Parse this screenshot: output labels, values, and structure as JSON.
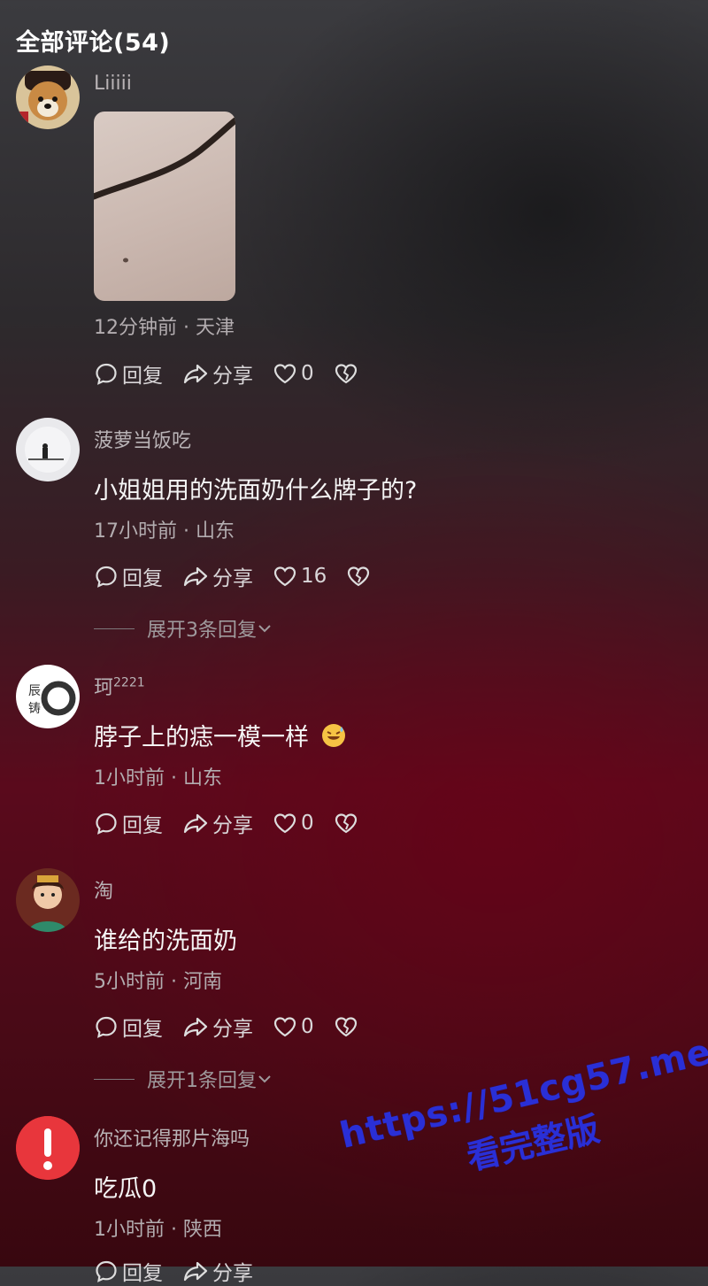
{
  "header": {
    "title": "全部评论(54)"
  },
  "comments": [
    {
      "name": "Liiiii",
      "text": "",
      "meta": "12分钟前 · 天津",
      "reply": "回复",
      "share": "分享",
      "likes": "0"
    },
    {
      "name": "菠萝当饭吃",
      "text": "小姐姐用的洗面奶什么牌子的?",
      "meta": "17小时前 · 山东",
      "reply": "回复",
      "share": "分享",
      "likes": "16",
      "expand": "展开3条回复"
    },
    {
      "name": "珂",
      "name_sup": "2221",
      "text": "脖子上的痣一模一样",
      "meta": "1小时前 · 山东",
      "reply": "回复",
      "share": "分享",
      "likes": "0"
    },
    {
      "name": "淘",
      "text": "谁给的洗面奶",
      "meta": "5小时前 · 河南",
      "reply": "回复",
      "share": "分享",
      "likes": "0",
      "expand": "展开1条回复"
    },
    {
      "name": "你还记得那片海吗",
      "text": "吃瓜0",
      "meta": "1小时前 · 陕西",
      "reply": "回复",
      "share": "分享"
    }
  ],
  "watermark": {
    "url": "https://51cg57.me",
    "sub": "看完整版"
  },
  "colors": {
    "accent_red": "#e8363c",
    "watermark_blue": "#2a2fd6"
  },
  "icons": [
    "reply-bubble-icon",
    "share-arrow-icon",
    "heart-icon",
    "broken-heart-icon",
    "chevron-down-icon",
    "warning-icon"
  ]
}
